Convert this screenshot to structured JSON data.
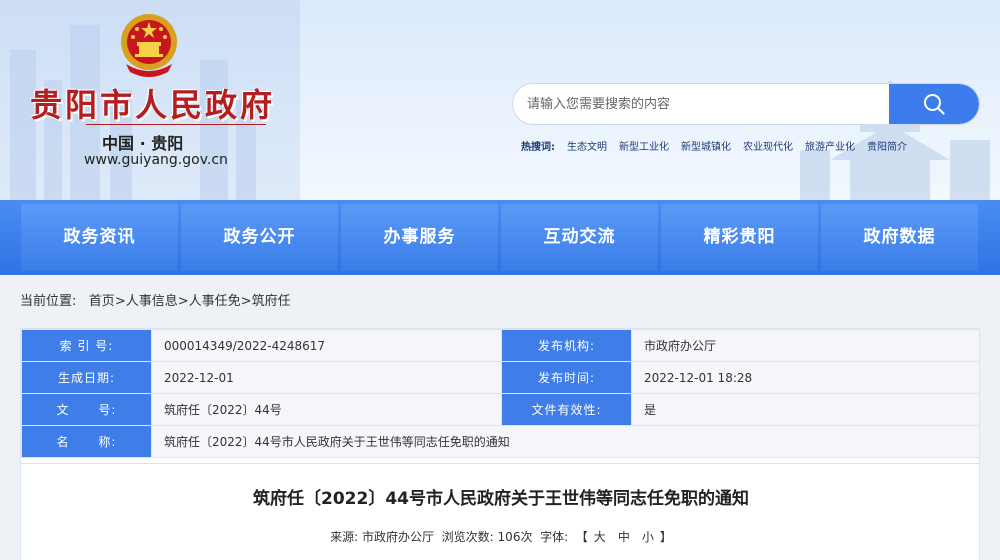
{
  "header": {
    "site_title": "贵阳市人民政府",
    "site_subtitle": "中国 · 贵阳",
    "site_url": "www.guiyang.gov.cn",
    "emblem_icon": "national-emblem-icon",
    "title_color": "#b41e1e"
  },
  "search": {
    "placeholder": "请输入您需要搜索的内容",
    "button_icon": "search-icon",
    "button_color": "#3d7cec"
  },
  "hot_words": {
    "label": "热搜词:",
    "items": [
      "生态文明",
      "新型工业化",
      "新型城镇化",
      "农业现代化",
      "旅游产业化",
      "贵阳简介"
    ]
  },
  "nav": {
    "items": [
      "政务资讯",
      "政务公开",
      "办事服务",
      "互动交流",
      "精彩贵阳",
      "政府数据"
    ],
    "bar_color": "#2f72e3"
  },
  "breadcrumb": {
    "prefix": "当前位置:",
    "items": [
      "首页",
      "人事信息",
      "人事任免",
      "筑府任"
    ],
    "separator": ">"
  },
  "info": {
    "index_label": "索 引 号:",
    "index_value": "000014349/2022-4248617",
    "publisher_label": "发布机构:",
    "publisher_value": "市政府办公厅",
    "created_label": "生成日期:",
    "created_value": "2022-12-01",
    "published_label": "发布时间:",
    "published_value": "2022-12-01 18:28",
    "doc_no_label": "文      号:",
    "doc_no_value": "筑府任〔2022〕44号",
    "validity_label": "文件有效性:",
    "validity_value": "是",
    "name_label": "名      称:",
    "name_value": "筑府任〔2022〕44号市人民政府关于王世伟等同志任免职的通知",
    "label_color": "#3f7ee9"
  },
  "article": {
    "title": "筑府任〔2022〕44号市人民政府关于王世伟等同志任免职的通知",
    "source_label": "来源:",
    "source_value": "市政府办公厅",
    "views_label": "浏览次数:",
    "views_value": "106次",
    "font_label": "字体:",
    "font_open": "【",
    "font_large": "大",
    "font_medium": "中",
    "font_small": "小",
    "font_close": "】"
  }
}
